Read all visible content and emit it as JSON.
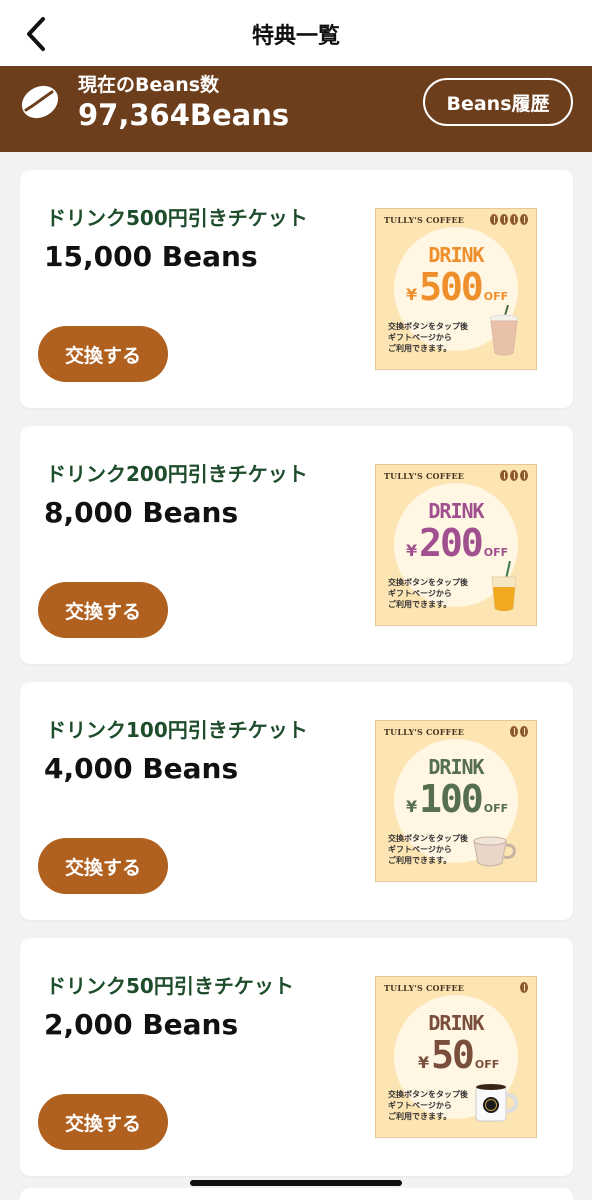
{
  "nav": {
    "title": "特典一覧"
  },
  "banner": {
    "label": "現在のBeans数",
    "value": "97,364Beans",
    "history_button": "Beans履歴"
  },
  "cards": [
    {
      "title": "ドリンク500円引きチケット",
      "cost": "15,000 Beans",
      "button": "交換する",
      "ticket": {
        "logo": "TULLY'S COFFEE",
        "drink": "DRINK",
        "yen": "¥",
        "amount": "500",
        "off": "OFF",
        "note": [
          "交換ボタンをタップ後",
          "ギフトページから",
          "ご利用できます。"
        ],
        "color": "#ef8f2c",
        "beans": 4
      }
    },
    {
      "title": "ドリンク200円引きチケット",
      "cost": "8,000 Beans",
      "button": "交換する",
      "ticket": {
        "logo": "TULLY'S COFFEE",
        "drink": "DRINK",
        "yen": "¥",
        "amount": "200",
        "off": "OFF",
        "note": [
          "交換ボタンをタップ後",
          "ギフトページから",
          "ご利用できます。"
        ],
        "color": "#a0508e",
        "beans": 3
      }
    },
    {
      "title": "ドリンク100円引きチケット",
      "cost": "4,000 Beans",
      "button": "交換する",
      "ticket": {
        "logo": "TULLY'S COFFEE",
        "drink": "DRINK",
        "yen": "¥",
        "amount": "100",
        "off": "OFF",
        "note": [
          "交換ボタンをタップ後",
          "ギフトページから",
          "ご利用できます。"
        ],
        "color": "#566f4f",
        "beans": 2
      }
    },
    {
      "title": "ドリンク50円引きチケット",
      "cost": "2,000 Beans",
      "button": "交換する",
      "ticket": {
        "logo": "TULLY'S COFFEE",
        "drink": "DRINK",
        "yen": "¥",
        "amount": "50",
        "off": "OFF",
        "note": [
          "交換ボタンをタップ後",
          "ギフトページから",
          "ご利用できます。"
        ],
        "color": "#7a4e3c",
        "beans": 1
      }
    }
  ],
  "theme": {
    "banner_bg": "#6d3e1c",
    "button_bg": "#b0601f",
    "title_green": "#1e4d2b"
  }
}
